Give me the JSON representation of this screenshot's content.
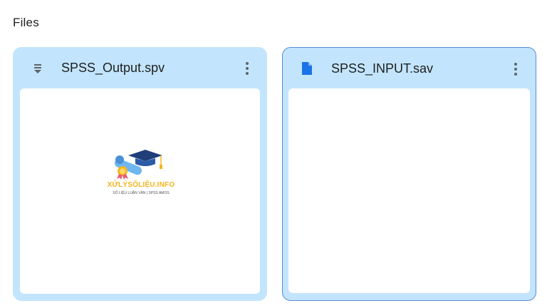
{
  "section": {
    "title": "Files"
  },
  "files": [
    {
      "name": "SPSS_Output.spv",
      "icon": "spv-file-icon",
      "selected": false,
      "preview": {
        "logo_title": "XỬLÝSỐLIỆU.INFO",
        "logo_subtitle": "SỐ LIỆU LUẬN VĂN | SPSS AMOS"
      }
    },
    {
      "name": "SPSS_INPUT.sav",
      "icon": "document-icon",
      "selected": true,
      "icon_color": "#1a73e8"
    }
  ],
  "colors": {
    "card_background": "#c2e5fd",
    "selected_border": "#5b8bd6",
    "document_icon": "#1a73e8",
    "logo_accent": "#f5b51f"
  }
}
